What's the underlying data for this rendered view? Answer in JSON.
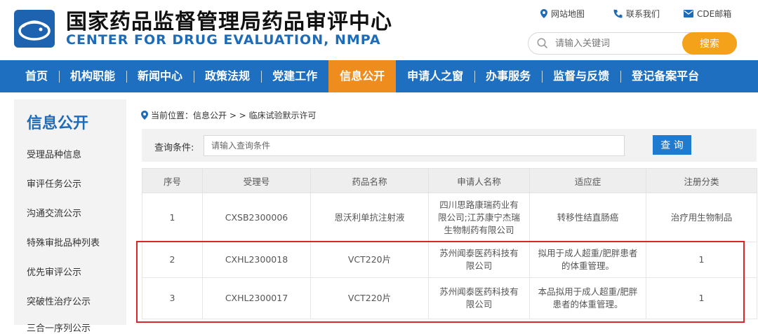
{
  "header": {
    "title": "国家药品监督管理局药品审评中心",
    "subtitle": "CENTER FOR DRUG EVALUATION, NMPA",
    "top_links": [
      "网站地图",
      "联系我们",
      "CDE邮箱"
    ],
    "search": {
      "placeholder": "请输入关键词",
      "button": "搜索"
    }
  },
  "nav": {
    "items": [
      "首页",
      "机构职能",
      "新闻中心",
      "政策法规",
      "党建工作",
      "信息公开",
      "申请人之窗",
      "办事服务",
      "监督与反馈",
      "登记备案平台"
    ],
    "active": "信息公开"
  },
  "sidebar": {
    "title": "信息公开",
    "items": [
      "受理品种信息",
      "审评任务公示",
      "沟通交流公示",
      "特殊审批品种列表",
      "优先审评公示",
      "突破性治疗公示",
      "三合一序列公示"
    ]
  },
  "breadcrumb": "当前位置：信息公开 > > 临床试验默示许可",
  "query": {
    "label": "查询条件:",
    "placeholder": "请输入查询条件",
    "button": "查 询"
  },
  "table": {
    "headers": [
      "序号",
      "受理号",
      "药品名称",
      "申请人名称",
      "适应症",
      "注册分类"
    ],
    "rows": [
      [
        "1",
        "CXSB2300006",
        "恩沃利单抗注射液",
        "四川思路康瑞药业有限公司;江苏康宁杰瑞生物制药有限公司",
        "转移性结直肠癌",
        "治疗用生物制品"
      ],
      [
        "2",
        "CXHL2300018",
        "VCT220片",
        "苏州闻泰医药科技有限公司",
        "拟用于成人超重/肥胖患者的体重管理。",
        "1"
      ],
      [
        "3",
        "CXHL2300017",
        "VCT220片",
        "苏州闻泰医药科技有限公司",
        "本品拟用于成人超重/肥胖患者的体重管理。",
        "1"
      ]
    ]
  },
  "colors": {
    "brand_blue": "#1f6fc0",
    "accent_orange": "#ef8c1e",
    "search_orange": "#f5a21b",
    "highlight_red": "#d9262c"
  }
}
